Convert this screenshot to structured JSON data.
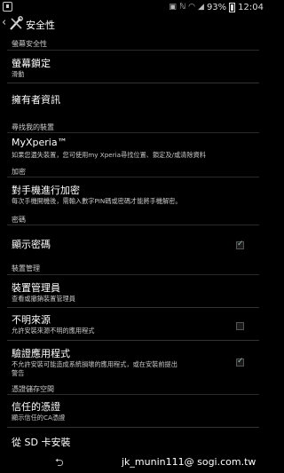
{
  "status_bar": {
    "battery": "93%",
    "time": "12:04"
  },
  "action_bar": {
    "title": "安全性",
    "back_icon": "chevron-left-icon",
    "app_icon": "tools-icon"
  },
  "sections": {
    "screen_security": "螢幕安全性",
    "find_device": "尋找我的裝置",
    "encryption": "加密",
    "passwords": "密碼",
    "device_admin": "裝置管理",
    "credential_storage": "憑證儲存空間"
  },
  "items": {
    "screen_lock": {
      "label": "螢幕鎖定",
      "sub": "滑動"
    },
    "owner_info": {
      "label": "擁有者資訊"
    },
    "myxperia": {
      "label": "MyXperia™",
      "sub": "如果您遺失裝置，您可使用my Xperia尋找位置、鎖定及/或清除資料"
    },
    "encrypt_phone": {
      "label": "對手機進行加密",
      "sub": "每次手機開機後，需輸入數字PIN碼或密碼才能將手機解密。"
    },
    "show_passwords": {
      "label": "顯示密碼",
      "checked": true
    },
    "device_admins": {
      "label": "裝置管理員",
      "sub": "查看或撤銷裝置管理員"
    },
    "unknown_sources": {
      "label": "不明來源",
      "sub": "允許安裝來源不明的應用程式",
      "checked": false
    },
    "verify_apps": {
      "label": "驗證應用程式",
      "sub": "不允許安裝可能造成系統損壞的應用程式，或在安裝前提出",
      "sub2": "警告",
      "checked": true
    },
    "trusted_credentials": {
      "label": "信任的憑證",
      "sub": "顯示信任的CA憑證"
    },
    "install_from_sd": {
      "label": "從 SD 卡安裝"
    }
  },
  "watermark": "jk_munin111@ sogi.com.tw"
}
